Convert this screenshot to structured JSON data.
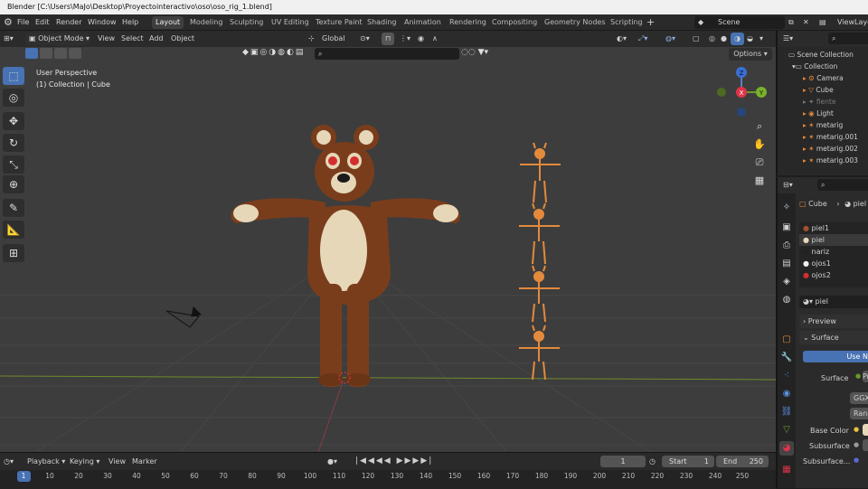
{
  "window": {
    "title": "Blender [C:\\Users\\MaJo\\Desktop\\Proyectointeractivo\\oso\\oso_rig_1.blend]"
  },
  "menu": {
    "items": [
      "File",
      "Edit",
      "Render",
      "Window",
      "Help"
    ]
  },
  "workspaces": [
    "Layout",
    "Modeling",
    "Sculpting",
    "UV Editing",
    "Texture Paint",
    "Shading",
    "Animation",
    "Rendering",
    "Compositing",
    "Geometry Nodes",
    "Scripting"
  ],
  "scene": {
    "name": "Scene",
    "view_layer": "ViewLayer"
  },
  "viewport_header": {
    "mode": "Object Mode",
    "menus": [
      "View",
      "Select",
      "Add",
      "Object"
    ],
    "orientation": "Global",
    "options_label": "Options"
  },
  "overlay": {
    "perspective": "User Perspective",
    "collection": "(1) Collection | Cube"
  },
  "gizmo": {
    "x": "X",
    "y": "Y",
    "z": "Z"
  },
  "outliner": {
    "root": "Scene Collection",
    "collection": "Collection",
    "items": [
      "Camera",
      "Cube",
      "fiente",
      "Light",
      "metarig",
      "metarig.001",
      "metarig.002",
      "metarig.003"
    ]
  },
  "properties": {
    "breadcrumb_object": "Cube",
    "breadcrumb_material": "piel",
    "materials": [
      "piel1",
      "piel",
      "nariz",
      "ojos1",
      "ojos2"
    ],
    "material_name": "piel",
    "preview_label": "Preview",
    "surface_label": "Surface",
    "use_nodes_label": "Use N",
    "surface_field": "Surface",
    "surface_value": "Pr",
    "ggx": "GGX",
    "random": "Rand",
    "base_color_label": "Base Color",
    "subsurface_label": "Subsurface",
    "subsurface2_label": "Subsurface..."
  },
  "timeline": {
    "menus": [
      "Playback",
      "Keying",
      "View",
      "Marker"
    ],
    "current_frame": "1",
    "start_label": "Start",
    "start": "1",
    "end_label": "End",
    "end": "250",
    "ticks": [
      "1",
      "10",
      "20",
      "30",
      "40",
      "50",
      "60",
      "70",
      "80",
      "90",
      "100",
      "110",
      "120",
      "130",
      "140",
      "150",
      "160",
      "170",
      "180",
      "190",
      "200",
      "210",
      "220",
      "230",
      "240",
      "250"
    ]
  },
  "colors": {
    "accent": "#4772b3",
    "bear_fur": "#7a3d1b",
    "bear_belly": "#e6d7b8",
    "rig": "#e38a3c",
    "viewport_bg": "#3d3d3d"
  }
}
